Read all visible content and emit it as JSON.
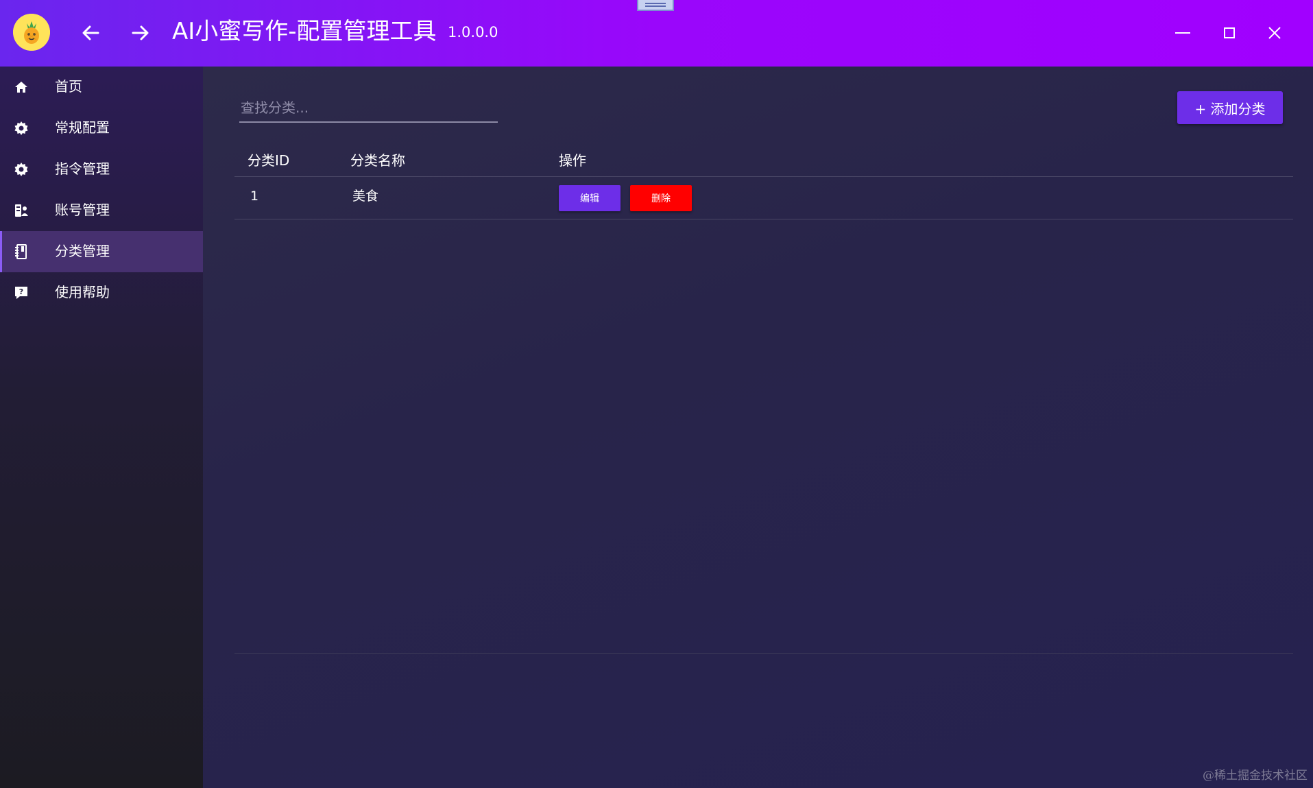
{
  "window": {
    "title": "AI小蜜写作-配置管理工具",
    "version": "1.0.0.0"
  },
  "titlebar": {
    "logo_icon": "pineapple-mascot-icon",
    "back_icon": "arrow-left-icon",
    "forward_icon": "arrow-right-icon",
    "minimize_icon": "minimize-icon",
    "maximize_icon": "maximize-icon",
    "close_icon": "close-icon"
  },
  "sidebar": {
    "items": [
      {
        "label": "首页",
        "icon": "home-icon",
        "active": false
      },
      {
        "label": "常规配置",
        "icon": "gear-icon",
        "active": false
      },
      {
        "label": "指令管理",
        "icon": "gear-icon",
        "active": false
      },
      {
        "label": "账号管理",
        "icon": "account-icon",
        "active": false
      },
      {
        "label": "分类管理",
        "icon": "notebook-icon",
        "active": true
      },
      {
        "label": "使用帮助",
        "icon": "help-icon",
        "active": false
      }
    ]
  },
  "main": {
    "search": {
      "placeholder": "查找分类...",
      "value": ""
    },
    "add_button_label": "+ 添加分类",
    "table": {
      "columns": [
        "分类ID",
        "分类名称",
        "操作"
      ],
      "rows": [
        {
          "id": "1",
          "name": "美食",
          "edit_label": "编辑",
          "delete_label": "删除"
        }
      ]
    }
  },
  "watermark": "@稀土掘金技术社区",
  "colors": {
    "accent": "#6d2ee8",
    "danger": "#ff0000",
    "titlebar_start": "#6a26ee",
    "titlebar_end": "#a100ff",
    "active_item": "#46306f"
  }
}
